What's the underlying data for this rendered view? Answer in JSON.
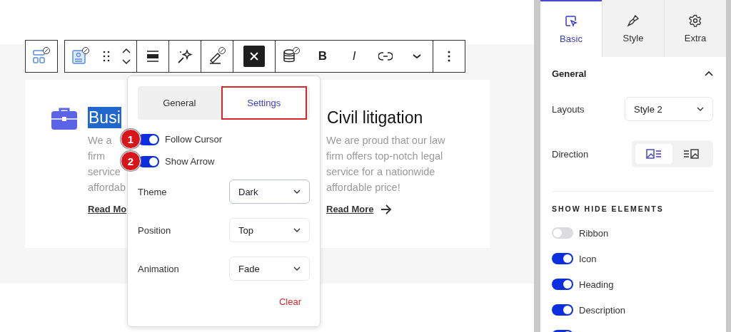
{
  "toolbar": {
    "groups": [
      [
        {
          "kind": "blocks"
        }
      ],
      [
        {
          "kind": "card"
        },
        {
          "kind": "drag"
        },
        {
          "kind": "mover"
        }
      ],
      [
        {
          "kind": "align"
        }
      ],
      [
        {
          "kind": "ai"
        }
      ],
      [
        {
          "kind": "highlight"
        }
      ],
      [
        {
          "kind": "close"
        }
      ],
      [
        {
          "kind": "database"
        },
        {
          "kind": "bold",
          "label": "B"
        },
        {
          "kind": "italic",
          "label": "I"
        },
        {
          "kind": "link"
        },
        {
          "kind": "more"
        }
      ],
      [
        {
          "kind": "options"
        }
      ]
    ]
  },
  "cards": [
    {
      "title": "Busi",
      "title_selected": true,
      "lines": [
        "We a",
        "firm",
        "service",
        "affordab"
      ],
      "link": "Read Mo",
      "icon": true
    },
    {
      "title": "Civil litigation",
      "title_selected": false,
      "lines": [
        "We are proud that our law",
        "firm offers top-notch legal",
        "service for a nationwide",
        "affordable price!"
      ],
      "link": "Read More",
      "arrow": true,
      "icon": false
    }
  ],
  "popover": {
    "tabs": [
      {
        "label": "General",
        "selected": false
      },
      {
        "label": "Settings",
        "selected": true
      }
    ],
    "toggles": [
      {
        "label": "Follow Cursor",
        "on": true,
        "badge": "1"
      },
      {
        "label": "Show Arrow",
        "on": true,
        "badge": "2"
      }
    ],
    "selects": [
      {
        "label": "Theme",
        "value": "Dark",
        "focused": true
      },
      {
        "label": "Position",
        "value": "Top",
        "focused": false
      },
      {
        "label": "Animation",
        "value": "Fade",
        "focused": false
      }
    ],
    "clear": "Clear"
  },
  "sidebar": {
    "tabs": [
      {
        "label": "Basic",
        "selected": true,
        "kind": "cursor"
      },
      {
        "label": "Style",
        "selected": false,
        "kind": "brush"
      },
      {
        "label": "Extra",
        "selected": false,
        "kind": "gear"
      }
    ],
    "section": {
      "title": "General",
      "expanded": true
    },
    "layouts": {
      "label": "Layouts",
      "value": "Style 2"
    },
    "direction": {
      "label": "Direction",
      "options": [
        {
          "kind": "image-left",
          "selected": true
        },
        {
          "kind": "image-right",
          "selected": false
        }
      ]
    },
    "elements_title": "SHOW HIDE ELEMENTS",
    "elements": [
      {
        "label": "Ribbon",
        "on": false
      },
      {
        "label": "Icon",
        "on": true
      },
      {
        "label": "Heading",
        "on": true
      },
      {
        "label": "Description",
        "on": true
      },
      {
        "on": true
      }
    ]
  }
}
